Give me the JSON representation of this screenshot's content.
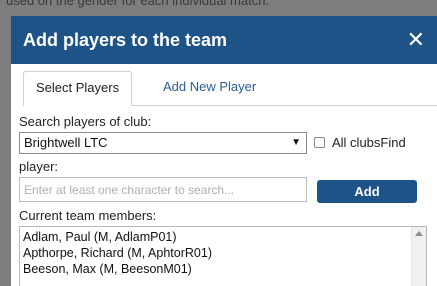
{
  "background": {
    "partial_text": "used on the gender for each individual match."
  },
  "dialog": {
    "title": "Add players to the team",
    "close_symbol": "✕"
  },
  "tabs": [
    {
      "label": "Select Players",
      "active": true
    },
    {
      "label": "Add New Player",
      "active": false
    }
  ],
  "club_search": {
    "label": "Search players of club:",
    "selected_club": "Brightwell LTC",
    "caret_icon": "chevron-down-icon",
    "all_clubs_label": "All clubs",
    "all_clubs_checked": false
  },
  "find_player": {
    "label_part1": "Find",
    "label_part2": "player:",
    "placeholder": "Enter at least one character to search...",
    "value": "",
    "add_label": "Add"
  },
  "current_team": {
    "label": "Current team members:",
    "members": [
      "Adlam, Paul (M, AdlamP01)",
      "Apthorpe, Richard (M, AphtorR01)",
      "Beeson, Max (M, BeesonM01)"
    ]
  },
  "colors": {
    "header": "#1d5387",
    "button": "#1d5387",
    "link": "#2a5d95"
  }
}
